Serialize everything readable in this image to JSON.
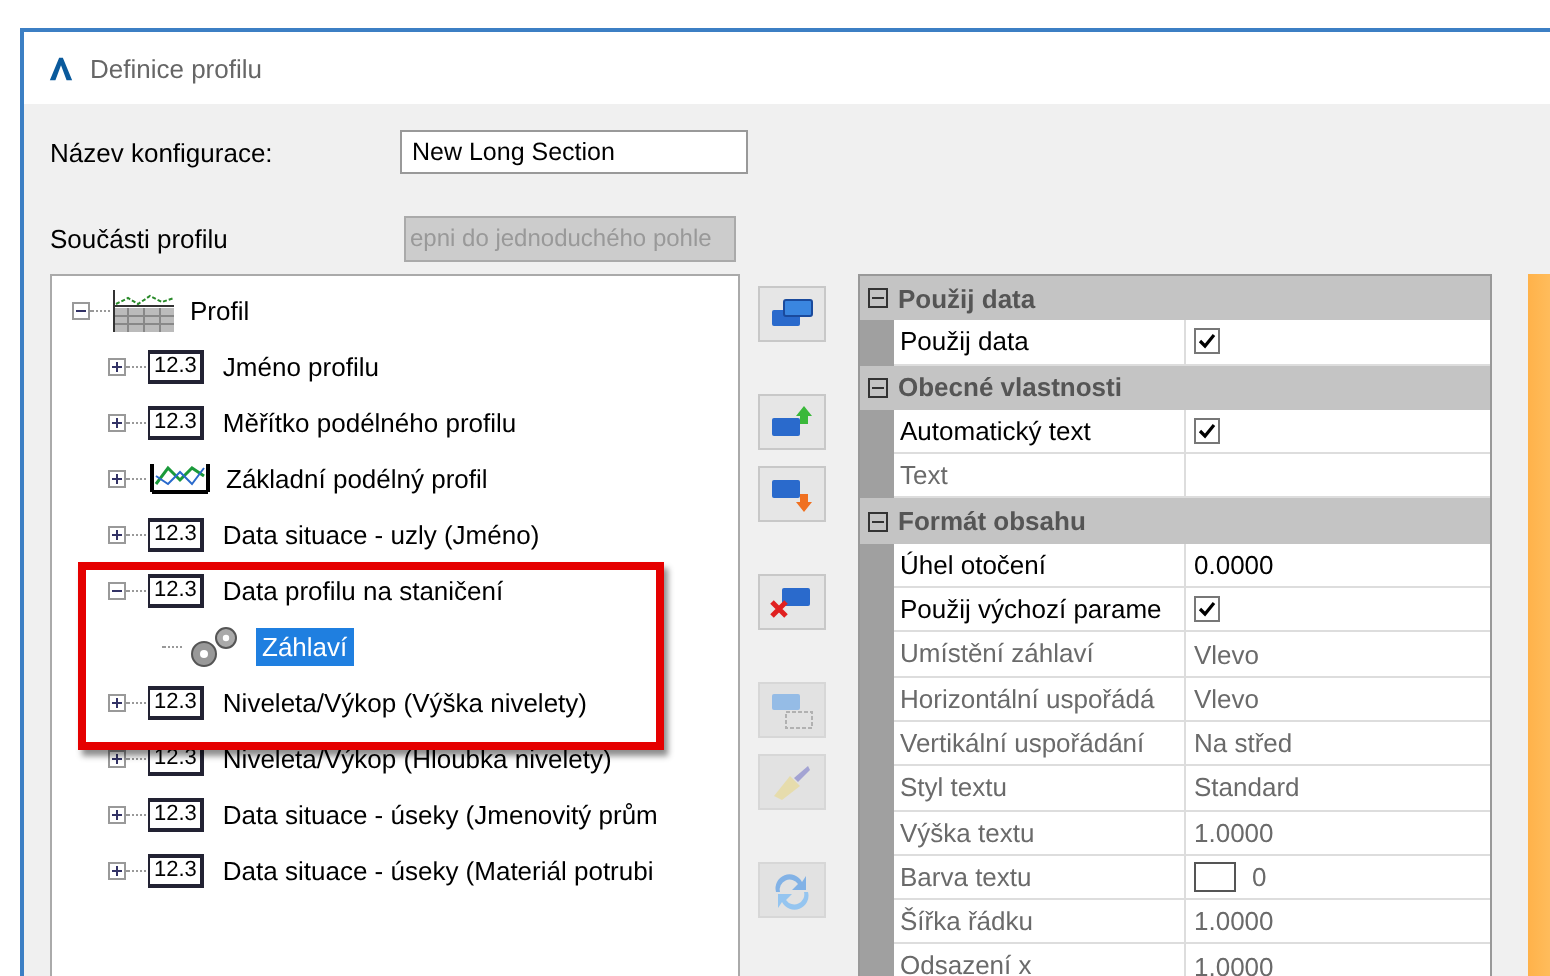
{
  "window": {
    "title": "Definice profilu"
  },
  "config_name": {
    "label": "Název konfigurace:",
    "value": "New Long Section"
  },
  "components": {
    "label": "Součásti profilu",
    "button": {
      "label": "epni do jednoduchého pohle",
      "disabled": true
    }
  },
  "tree": [
    {
      "label": "Profil",
      "kind": "table-chart",
      "expanded": true,
      "selected": false,
      "children": [
        {
          "label": "Jméno profilu",
          "kind": "number",
          "icon_text": "12.3",
          "expanded": false,
          "selected": false
        },
        {
          "label": "Měřítko podélného profilu",
          "kind": "number",
          "icon_text": "12.3",
          "expanded": false,
          "selected": false
        },
        {
          "label": "Základní podélný profil",
          "kind": "line-chart",
          "expanded": false,
          "selected": false
        },
        {
          "label": "Data situace - uzly (Jméno)",
          "kind": "number",
          "icon_text": "12.3",
          "expanded": false,
          "selected": false
        },
        {
          "label": "Data profilu na staničení",
          "kind": "number",
          "icon_text": "12.3",
          "expanded": true,
          "selected": false,
          "children": [
            {
              "label": "Záhlaví",
              "kind": "gears",
              "selected": true
            }
          ]
        },
        {
          "label": "Niveleta/Výkop (Výška nivelety)",
          "kind": "number",
          "icon_text": "12.3",
          "expanded": false,
          "selected": false
        },
        {
          "label": "Niveleta/Výkop (Hloubka nivelety)",
          "kind": "number",
          "icon_text": "12.3",
          "expanded": false,
          "selected": false
        },
        {
          "label": "Data situace - úseky (Jmenovitý prům",
          "kind": "number",
          "icon_text": "12.3",
          "expanded": false,
          "selected": false
        },
        {
          "label": "Data situace - úseky (Materiál potrubi",
          "kind": "number",
          "icon_text": "12.3",
          "expanded": false,
          "selected": false
        }
      ]
    }
  ],
  "side_buttons": [
    {
      "kind": "copy",
      "disabled": false
    },
    {
      "kind": "move-up",
      "disabled": false
    },
    {
      "kind": "move-down",
      "disabled": false
    },
    {
      "kind": "delete",
      "disabled": false
    },
    {
      "kind": "select",
      "disabled": true
    },
    {
      "kind": "brush",
      "disabled": true
    },
    {
      "kind": "refresh",
      "disabled": true
    }
  ],
  "properties": [
    {
      "title": "Použij data",
      "expanded": true,
      "rows": [
        {
          "label": "Použij data",
          "kind": "check",
          "checked": true,
          "disabled": false
        }
      ]
    },
    {
      "title": "Obecné vlastnosti",
      "expanded": true,
      "rows": [
        {
          "label": "Automatický text",
          "kind": "check",
          "checked": true,
          "disabled": false
        },
        {
          "label": "Text",
          "kind": "text",
          "disabled": true
        }
      ]
    },
    {
      "title": "Formát obsahu",
      "expanded": true,
      "rows": [
        {
          "label": "Úhel otočení",
          "kind": "text",
          "value": "0.0000",
          "disabled": false
        },
        {
          "label": "Použij výchozí parame",
          "kind": "check",
          "checked": true,
          "disabled": false
        },
        {
          "label": "Umístění záhlaví",
          "kind": "text",
          "value": "Vlevo",
          "disabled": true
        },
        {
          "label": "Horizontální uspořádá",
          "kind": "text",
          "value": "Vlevo",
          "disabled": true
        },
        {
          "label": "Vertikální uspořádání",
          "kind": "text",
          "value": "Na střed",
          "disabled": true
        },
        {
          "label": "Styl textu",
          "kind": "text",
          "value": "Standard",
          "disabled": true
        },
        {
          "label": "Výška textu",
          "kind": "text",
          "value": "1.0000",
          "disabled": true
        },
        {
          "label": "Barva textu",
          "kind": "color",
          "color": "#ffffff",
          "value": "0",
          "disabled": true
        },
        {
          "label": "Šířka řádku",
          "kind": "text",
          "value": "1.0000",
          "disabled": true
        },
        {
          "label": "Odsazení x",
          "kind": "text",
          "value": "1.0000",
          "disabled": true
        }
      ]
    }
  ]
}
